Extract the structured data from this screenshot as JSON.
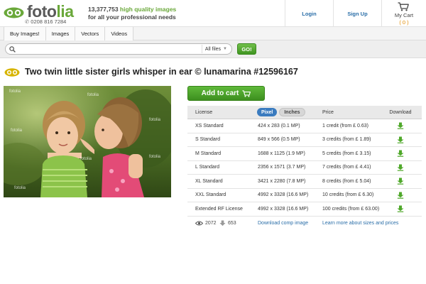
{
  "brand": {
    "logo_prefix": "foto",
    "logo_suffix": "lia",
    "phone": "0208 816 7284",
    "stock_count": "13,377,753",
    "hq_label": "high quality images",
    "tagline_rest": "for all your professional needs"
  },
  "header": {
    "login_label": "Login",
    "signup_label": "Sign Up",
    "cart_label": "My Cart",
    "cart_count": "( 0 )"
  },
  "nav": {
    "items": [
      "Buy Images!",
      "Images",
      "Vectors",
      "Videos"
    ]
  },
  "search": {
    "value": "",
    "filter": "All files",
    "go_label": "GO!"
  },
  "content": {
    "title": "Two twin little sister girls whisper in ear © lunamarina #12596167",
    "watermark": "fotolia",
    "add_to_cart_label": "Add to cart"
  },
  "license_table": {
    "headers": {
      "license": "License",
      "pixel": "Pixel",
      "inches": "Inches",
      "price": "Price",
      "download": "Download"
    },
    "rows": [
      {
        "license": "XS Standard",
        "size": "424 x 283 (0.1 MP)",
        "price": "1 credit (from £ 0.63)"
      },
      {
        "license": "S Standard",
        "size": "849 x 566 (0.5 MP)",
        "price": "3 credits (from £ 1.89)"
      },
      {
        "license": "M Standard",
        "size": "1688 x 1125 (1.9 MP)",
        "price": "5 credits (from £ 3.15)"
      },
      {
        "license": "L Standard",
        "size": "2356 x 1571 (3.7 MP)",
        "price": "7 credits (from £ 4.41)"
      },
      {
        "license": "XL Standard",
        "size": "3421 x 2280 (7.8 MP)",
        "price": "8 credits (from £ 5.04)"
      },
      {
        "license": "XXL Standard",
        "size": "4992 x 3328 (16.6 MP)",
        "price": "10 credits (from £ 6.30)"
      },
      {
        "license": "Extended RF License",
        "size": "4992 x 3328 (16.6 MP)",
        "price": "100 credits (from £ 63.00)"
      }
    ],
    "footer": {
      "views": "2072",
      "downloads": "653",
      "comp_link": "Download comp image",
      "learn_link": "Learn more about sizes and prices"
    }
  },
  "colors": {
    "brand_green": "#6aa83a",
    "link_blue": "#2a6ea8",
    "toggle_blue": "#3a7bbf",
    "cart_orange": "#e08a00"
  },
  "icons": [
    "logo-rings-icon",
    "phone-icon",
    "cart-icon",
    "search-icon",
    "chevron-down-icon",
    "cart-icon-small",
    "download-icon",
    "eye-icon",
    "download-count-icon"
  ]
}
